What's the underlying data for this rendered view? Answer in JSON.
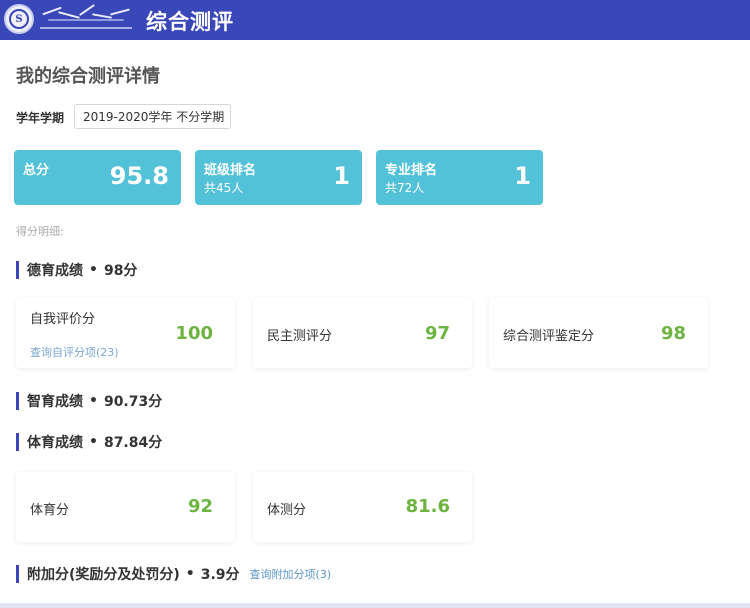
{
  "header": {
    "title": "综合测评",
    "logo_emblem": "S"
  },
  "page": {
    "title": "我的综合测评详情",
    "term_label": "学年学期",
    "term_value": "2019-2020学年 不分学期",
    "detail_label": "得分明细:"
  },
  "stats": [
    {
      "label": "总分",
      "sub": "",
      "value": "95.8"
    },
    {
      "label": "班级排名",
      "sub": "共45人",
      "value": "1"
    },
    {
      "label": "专业排名",
      "sub": "共72人",
      "value": "1"
    }
  ],
  "sections": {
    "moral": {
      "name": "德育成绩",
      "score": "98分",
      "items": [
        {
          "label": "自我评价分",
          "value": "100",
          "link": "查询自评分项(23)"
        },
        {
          "label": "民主测评分",
          "value": "97"
        },
        {
          "label": "综合测评鉴定分",
          "value": "98"
        }
      ]
    },
    "intellect": {
      "name": "智育成绩",
      "score": "90.73分"
    },
    "physical": {
      "name": "体育成绩",
      "score": "87.84分",
      "items": [
        {
          "label": "体育分",
          "value": "92"
        },
        {
          "label": "体测分",
          "value": "81.6"
        }
      ]
    },
    "bonus": {
      "name": "附加分(奖励分及处罚分)",
      "score": "3.9分",
      "link": "查询附加分项(3)"
    }
  },
  "colors": {
    "header": "#3a47b8",
    "stat_card": "#53c1d7",
    "score_green": "#6db33f",
    "link": "#5a95c9"
  }
}
